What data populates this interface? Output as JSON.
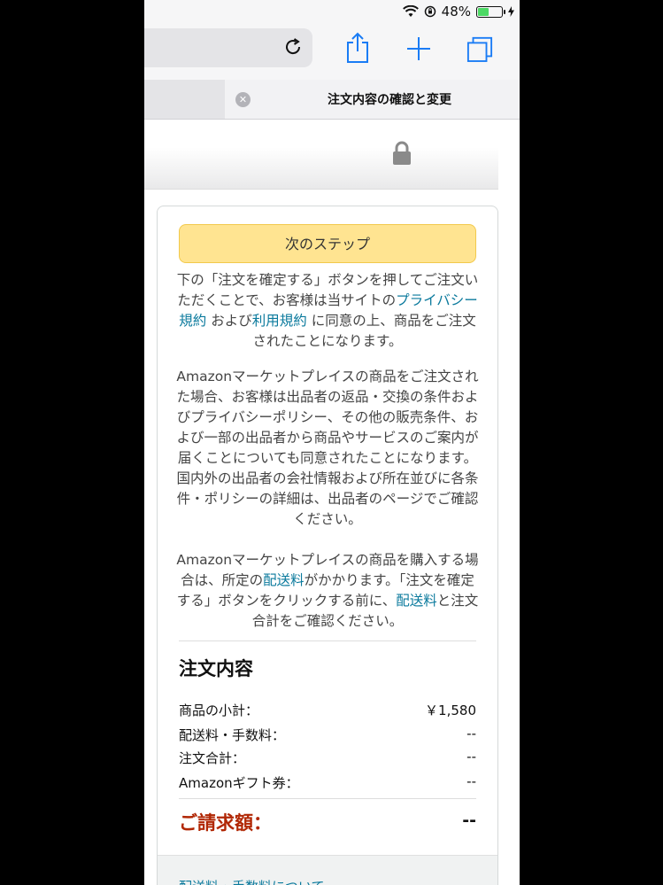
{
  "status": {
    "battery_percent": "48%",
    "battery_level": 0.48
  },
  "tab": {
    "title": "注文内容の確認と変更",
    "close_glyph": "✕"
  },
  "checkout": {
    "next_button": "次のステップ",
    "para1": {
      "t1": "下の「注文を確定する」ボタンを押してご注文いただくことで、お客様は当サイトの",
      "link1": "プライバシー規約",
      "t2": " および",
      "link2": "利用規約",
      "t3": " に同意の上、商品をご注文されたことになります。"
    },
    "para2": "Amazonマーケットプレイスの商品をご注文された場合、お客様は出品者の返品・交換の条件およびプライバシーポリシー、その他の販売条件、および一部の出品者から商品やサービスのご案内が届くことについても同意されたことになります。国内外の出品者の会社情報および所在並びに各条件・ポリシーの詳細は、出品者のページでご確認ください。",
    "para3": {
      "t1": "Amazonマーケットプレイスの商品を購入する場合は、所定の",
      "link1": "配送料",
      "t2": "がかかります。「注文を確定する」ボタンをクリックする前に、",
      "link2": "配送料",
      "t3": "と注文合計をご確認ください。"
    }
  },
  "summary": {
    "title": "注文内容",
    "rows": [
      {
        "label": "商品の小計：",
        "value": "￥1,580"
      },
      {
        "label": "配送料・手数料：",
        "value": "--"
      },
      {
        "label": "注文合計：",
        "value": "--"
      },
      {
        "label": "Amazonギフト券：",
        "value": "--"
      }
    ],
    "total_label": "ご請求額：",
    "total_value": "--",
    "footer_link": "配送料・手数料について"
  },
  "icons": [
    "wifi-icon",
    "orientation-lock-icon",
    "battery-icon",
    "charging-icon",
    "reload-icon",
    "share-icon",
    "new-tab-icon",
    "tabs-icon",
    "close-tab-icon",
    "lock-icon"
  ],
  "colors": {
    "button": "#ffe491",
    "link": "#0b7a9d",
    "total": "#b12704"
  }
}
